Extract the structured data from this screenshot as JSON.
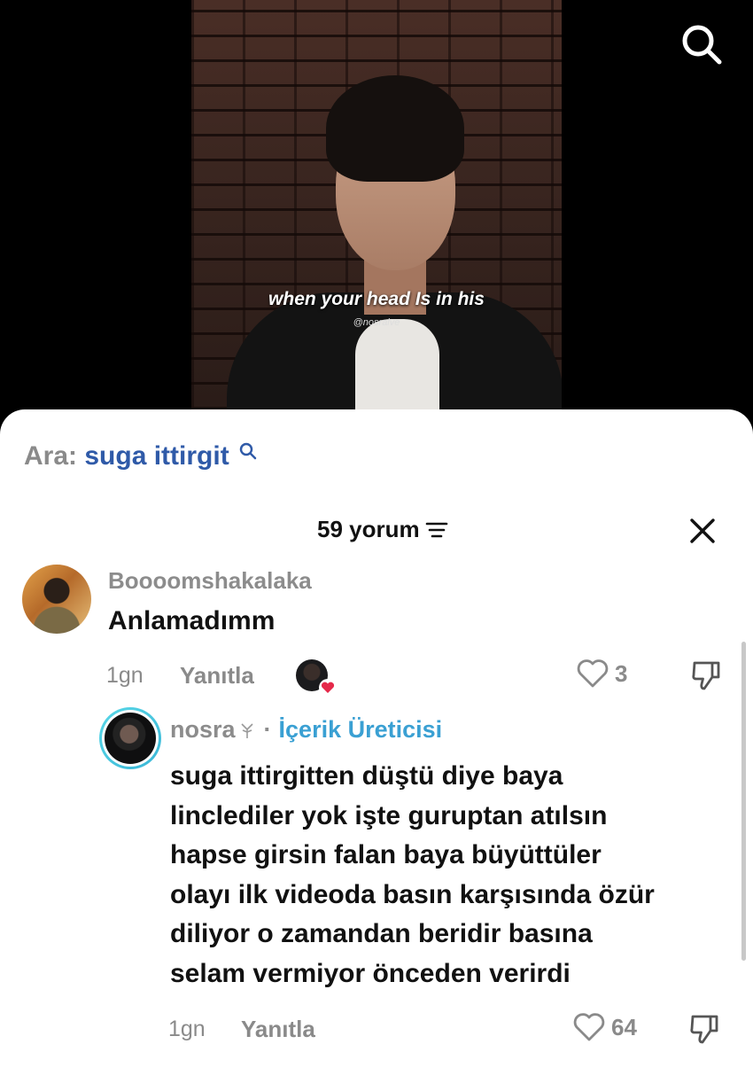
{
  "video": {
    "caption": "when your head Is in his",
    "handle": "@nosraive"
  },
  "search": {
    "prefix": "Ara:",
    "query": "suga ittirgit"
  },
  "comments_header": {
    "count_label": "59 yorum"
  },
  "comments": [
    {
      "username": "Boooomshakalaka",
      "text": "Anlamadımm",
      "time": "1gn",
      "reply_label": "Yanıtla",
      "likes": "3"
    }
  ],
  "reply": {
    "username": "nosra",
    "badge": "İçerik Üreticisi",
    "text": "suga ittirgitten düştü diye baya\nlinclediler yok işte guruptan atılsın\nhapse girsin falan baya büyüttüler\nolayı ilk videoda basın karşısında özür\ndiliyor o zamandan beridir basına\nselam vermiyor önceden verirdi",
    "time": "1gn",
    "reply_label": "Yanıtla",
    "likes": "64"
  },
  "colors": {
    "creator_badge": "#3aa0d3",
    "search_query": "#2f5aa8",
    "heart_red": "#e5294a"
  },
  "icons": [
    "search-icon",
    "filter-icon",
    "close-icon",
    "heart-icon",
    "dislike-icon"
  ]
}
